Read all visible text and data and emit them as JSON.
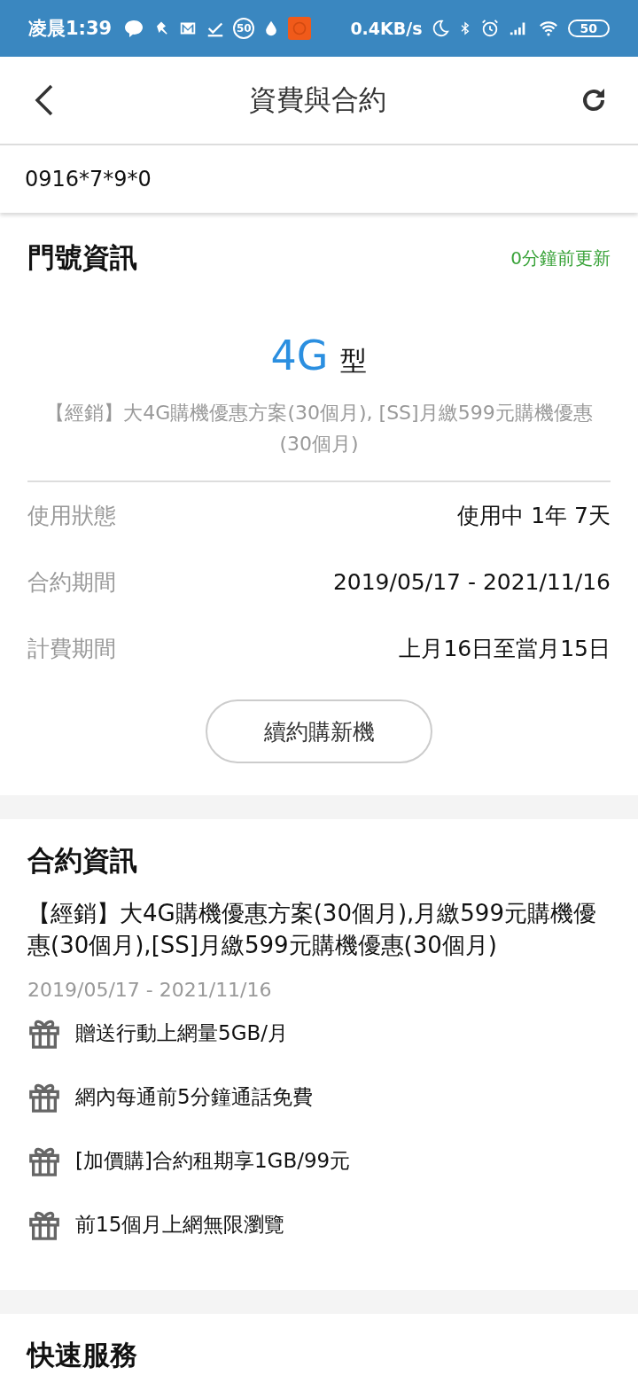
{
  "status_bar": {
    "time": "凌晨1:39",
    "net_speed": "0.4KB/s",
    "battery": "50",
    "badge": "50"
  },
  "header": {
    "title": "資費與合約"
  },
  "phone_number": "0916*7*9*0",
  "line_info": {
    "title": "門號資訊",
    "updated": "0分鐘前更新",
    "network": "4G",
    "network_suffix": "型",
    "plan": "【經銷】大4G購機優惠方案(30個月), [SS]月繳599元購機優惠(30個月)",
    "rows": [
      {
        "label": "使用狀態",
        "value": "使用中 1年 7天"
      },
      {
        "label": "合約期間",
        "value": "2019/05/17 - 2021/11/16"
      },
      {
        "label": "計費期間",
        "value": "上月16日至當月15日"
      }
    ],
    "button": "續約購新機"
  },
  "contract": {
    "title": "合約資訊",
    "description": "【經銷】大4G購機優惠方案(30個月),月繳599元購機優惠(30個月),[SS]月繳599元購機優惠(30個月)",
    "period": "2019/05/17 - 2021/11/16",
    "benefits": [
      "贈送行動上網量5GB/月",
      "網內每通前5分鐘通話免費",
      "[加價購]合約租期享1GB/99元",
      "前15個月上網無限瀏覽"
    ]
  },
  "quick_services": {
    "title": "快速服務"
  }
}
